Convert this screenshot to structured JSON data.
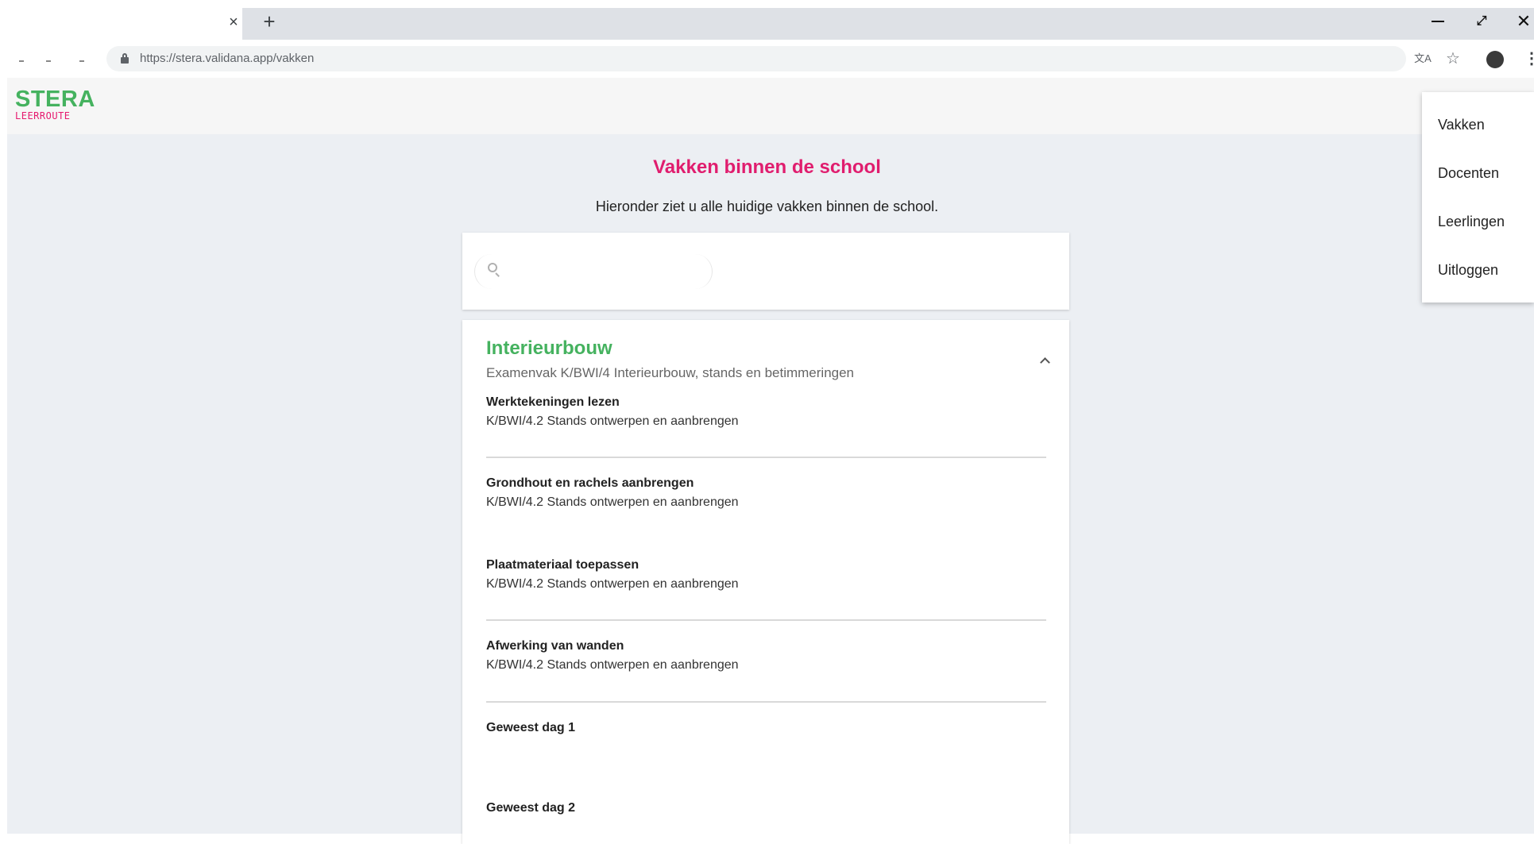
{
  "browser": {
    "tab_close_glyph": "×",
    "new_tab_glyph": "+",
    "window_max_glyph": "⤢",
    "window_close_glyph": "✕",
    "url": "https://stera.validana.app/vakken",
    "translate_glyph": "文A",
    "star_glyph": "☆",
    "menu_glyph": "⋮"
  },
  "app": {
    "logo_main": "STERA",
    "logo_sub": "LEERROUTE",
    "page_title": "Vakken binnen de school",
    "page_subtitle": "Hieronder ziet u alle huidige vakken binnen de school.",
    "search": {
      "value": "",
      "placeholder": ""
    },
    "subject": {
      "title": "Interieurbouw",
      "description": "Examenvak K/BWI/4 Interieurbouw, stands en betimmeringen",
      "items": [
        {
          "title": "Werktekeningen lezen",
          "code": "K/BWI/4.2 Stands ontwerpen en aanbrengen"
        },
        {
          "title": "Grondhout en rachels aanbrengen",
          "code": "K/BWI/4.2 Stands ontwerpen en aanbrengen"
        },
        {
          "title": "Plaatmateriaal toepassen",
          "code": "K/BWI/4.2 Stands ontwerpen en aanbrengen"
        },
        {
          "title": "Afwerking van wanden",
          "code": "K/BWI/4.2 Stands ontwerpen en aanbrengen"
        },
        {
          "title": "Geweest dag 1",
          "code": ""
        },
        {
          "title": "Geweest dag 2",
          "code": ""
        }
      ]
    },
    "menu": {
      "items": [
        "Vakken",
        "Docenten",
        "Leerlingen",
        "Uitloggen"
      ]
    },
    "colors": {
      "brand_green": "#45b25f",
      "brand_pink": "#e01d6e",
      "background": "#eceff3"
    }
  }
}
